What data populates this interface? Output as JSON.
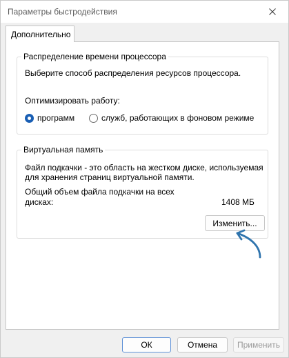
{
  "window": {
    "title": "Параметры быстродействия",
    "close_glyph": "close-icon"
  },
  "tabs": [
    {
      "label": "Дополнительно",
      "active": true
    }
  ],
  "processor_group": {
    "title": "Распределение времени процессора",
    "description": "Выберите способ распределения ресурсов процессора.",
    "optimize_label": "Оптимизировать работу:",
    "options": [
      {
        "label": "программ",
        "checked": true
      },
      {
        "label": "служб, работающих в фоновом режиме",
        "checked": false
      }
    ]
  },
  "virtual_memory_group": {
    "title": "Виртуальная память",
    "description_line1": "Файл подкачки - это область на жестком диске, используемая",
    "description_line2": "для хранения страниц виртуальной памяти.",
    "total_label_line1": "Общий объем файла подкачки на всех",
    "total_label_line2": "дисках:",
    "total_value": "1408 МБ",
    "change_button": "Изменить..."
  },
  "footer": {
    "ok": "ОК",
    "cancel": "Отмена",
    "apply": "Применить"
  },
  "colors": {
    "accent": "#1a5fb4",
    "annotation_arrow": "#2f74ad"
  }
}
